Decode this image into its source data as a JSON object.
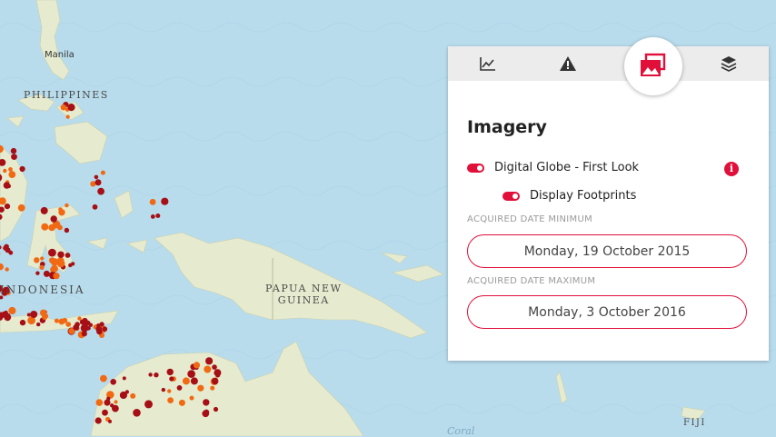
{
  "map": {
    "labels": {
      "manila": "Manila",
      "philippines": "PHILIPPINES",
      "indonesia": "INDONESIA",
      "papua_new_guinea_line1": "PAPUA NEW",
      "papua_new_guinea_line2": "GUINEA",
      "fiji": "FIJI",
      "coral": "Coral"
    },
    "colors": {
      "ocean": "#b9dcec",
      "land": "#e6ebcf",
      "point_dark": "#a50f15",
      "point_orange": "#f16913"
    }
  },
  "panel": {
    "tabs": [
      {
        "name": "chart",
        "icon": "line-chart-icon"
      },
      {
        "name": "alerts",
        "icon": "warning-icon"
      },
      {
        "name": "imagery",
        "icon": "imagery-icon",
        "active": true
      },
      {
        "name": "layers",
        "icon": "layers-icon"
      }
    ],
    "title": "Imagery",
    "layer_toggle": {
      "label": "Digital Globe - First Look",
      "enabled": true,
      "info_icon": "info-icon"
    },
    "footprints_toggle": {
      "label": "Display Footprints",
      "enabled": true
    },
    "date_min": {
      "label": "ACQUIRED DATE MINIMUM",
      "value": "Monday, 19 October 2015"
    },
    "date_max": {
      "label": "ACQUIRED DATE MAXIMUM",
      "value": "Monday, 3 October 2016"
    },
    "accent_color": "#e0103a"
  }
}
